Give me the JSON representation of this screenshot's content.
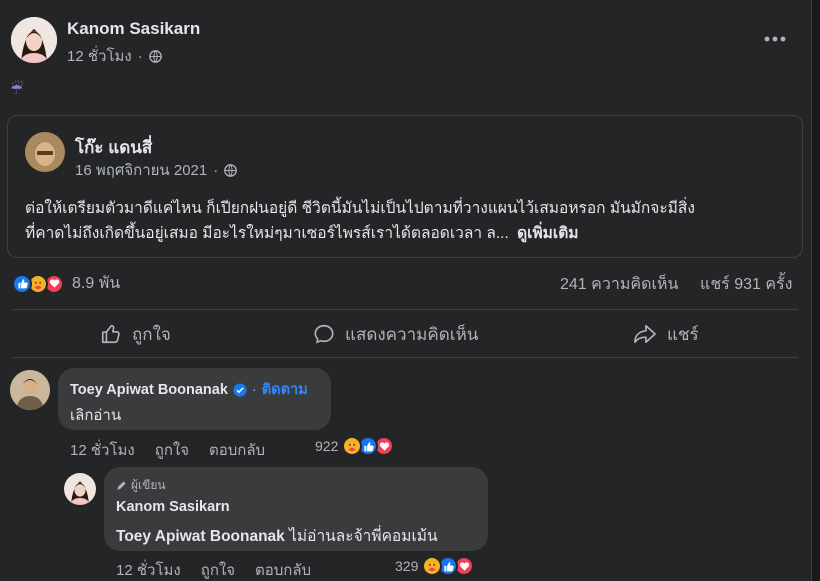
{
  "post": {
    "author": "Kanom Sasikarn",
    "time": "12 ชั่วโมง",
    "emoji": "☔",
    "more_icon": "more-horizontal-icon",
    "privacy_icon": "globe-icon"
  },
  "shared": {
    "author": "โก๊ะ แดนสี่",
    "date": "16 พฤศจิกายน 2021",
    "text_line1": "ต่อให้เตรียมตัวมาดีแค่ไหน ก็เปียกฝนอยู่ดี ชีวิตนี้มันไม่เป็นไปตามที่วางแผนไว้เสมอหรอก มันมักจะมีสิ่ง",
    "text_line2": "ที่คาดไม่ถึงเกิดขึ้นอยู่เสมอ มีอะไรใหม่ๆมาเซอร์ไพรส์เราได้ตลอดเวลา ล...",
    "see_more": "ดูเพิ่มเติม"
  },
  "stats": {
    "reactions_count": "8.9 พัน",
    "comments": "241 ความคิดเห็น",
    "shares": "แชร์ 931 ครั้ง"
  },
  "actions": {
    "like": "ถูกใจ",
    "comment": "แสดงความคิดเห็น",
    "share": "แชร์"
  },
  "comments": [
    {
      "author": "Toey Apiwat Boonanak",
      "follow": "ติดตาม",
      "text": "เลิกอ่าน",
      "time": "12 ชั่วโมง",
      "like": "ถูกใจ",
      "reply": "ตอบกลับ",
      "reaction_count": "922"
    }
  ],
  "reply": {
    "badge": "ผู้เขียน",
    "author": "Kanom Sasikarn",
    "mention": "Toey Apiwat Boonanak",
    "text": " ไม่อ่านละจ้าพี่คอมเม้น",
    "time": "12 ชั่วโมง",
    "like": "ถูกใจ",
    "reply": "ตอบกลับ",
    "reaction_count": "329"
  },
  "colors": {
    "like_blue": "#1877f2",
    "love_red": "#f33e58",
    "care_yellow": "#f7b125",
    "link_blue": "#2d88ff"
  }
}
